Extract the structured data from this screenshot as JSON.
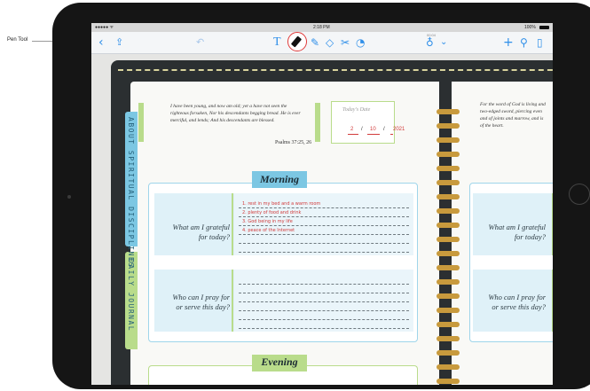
{
  "callout": {
    "label": "Pen Tool"
  },
  "status_bar": {
    "signal": "●●●●● ᯤ",
    "time": "2:18 PM",
    "center_small": "00:04",
    "battery": "100%"
  },
  "toolbar": {
    "back_icon": "chevron-left-icon",
    "share_icon": "share-icon",
    "undo_icon": "undo-icon",
    "text_tool_icon": "text-tool-icon",
    "pen_tool_icon": "pen-icon",
    "highlighter_icon": "highlighter-icon",
    "eraser_icon": "eraser-icon",
    "lasso_icon": "lasso-icon",
    "shapes_icon": "shapes-icon",
    "mic_icon": "microphone-icon",
    "add_icon": "plus-icon",
    "wrench_icon": "wrench-icon",
    "pages_icon": "pages-icon",
    "accent": "#2f8fe9"
  },
  "planner": {
    "side_tabs": [
      "ABOUT SPIRITUAL DISCIPLINES",
      "DAILY JOURNAL"
    ],
    "quote_lines": [
      "I have been young, and now am old; yet a have not seen the",
      "righteous forsaken, Nor his descendants begging bread. He is ever",
      "merciful, and lends; And his descendants are blessed."
    ],
    "quote_ref": "Psalms 37:25, 26",
    "date_title": "Today's Date",
    "date": {
      "month": "2",
      "day": "10",
      "year": "2021"
    },
    "morning_label": "Morning",
    "evening_label": "Evening",
    "grateful_q": [
      "What am I grateful",
      "for today?"
    ],
    "pray_q": [
      "Who can I pray for",
      "or serve this day?"
    ],
    "handwritten": [
      "1. rest in my bed and a warm room",
      "2. plenty of food and drink",
      "3. God being in my life",
      "4. peace of the Internet"
    ],
    "right_quote_lines": [
      "For the word of God is living and",
      "two-edged sword, piercing even",
      "and of joints and marrow, and is",
      "of the heart."
    ],
    "colors": {
      "blue": "#7cc7e3",
      "green": "#b9dc8b",
      "ink": "#d23b3b"
    }
  }
}
